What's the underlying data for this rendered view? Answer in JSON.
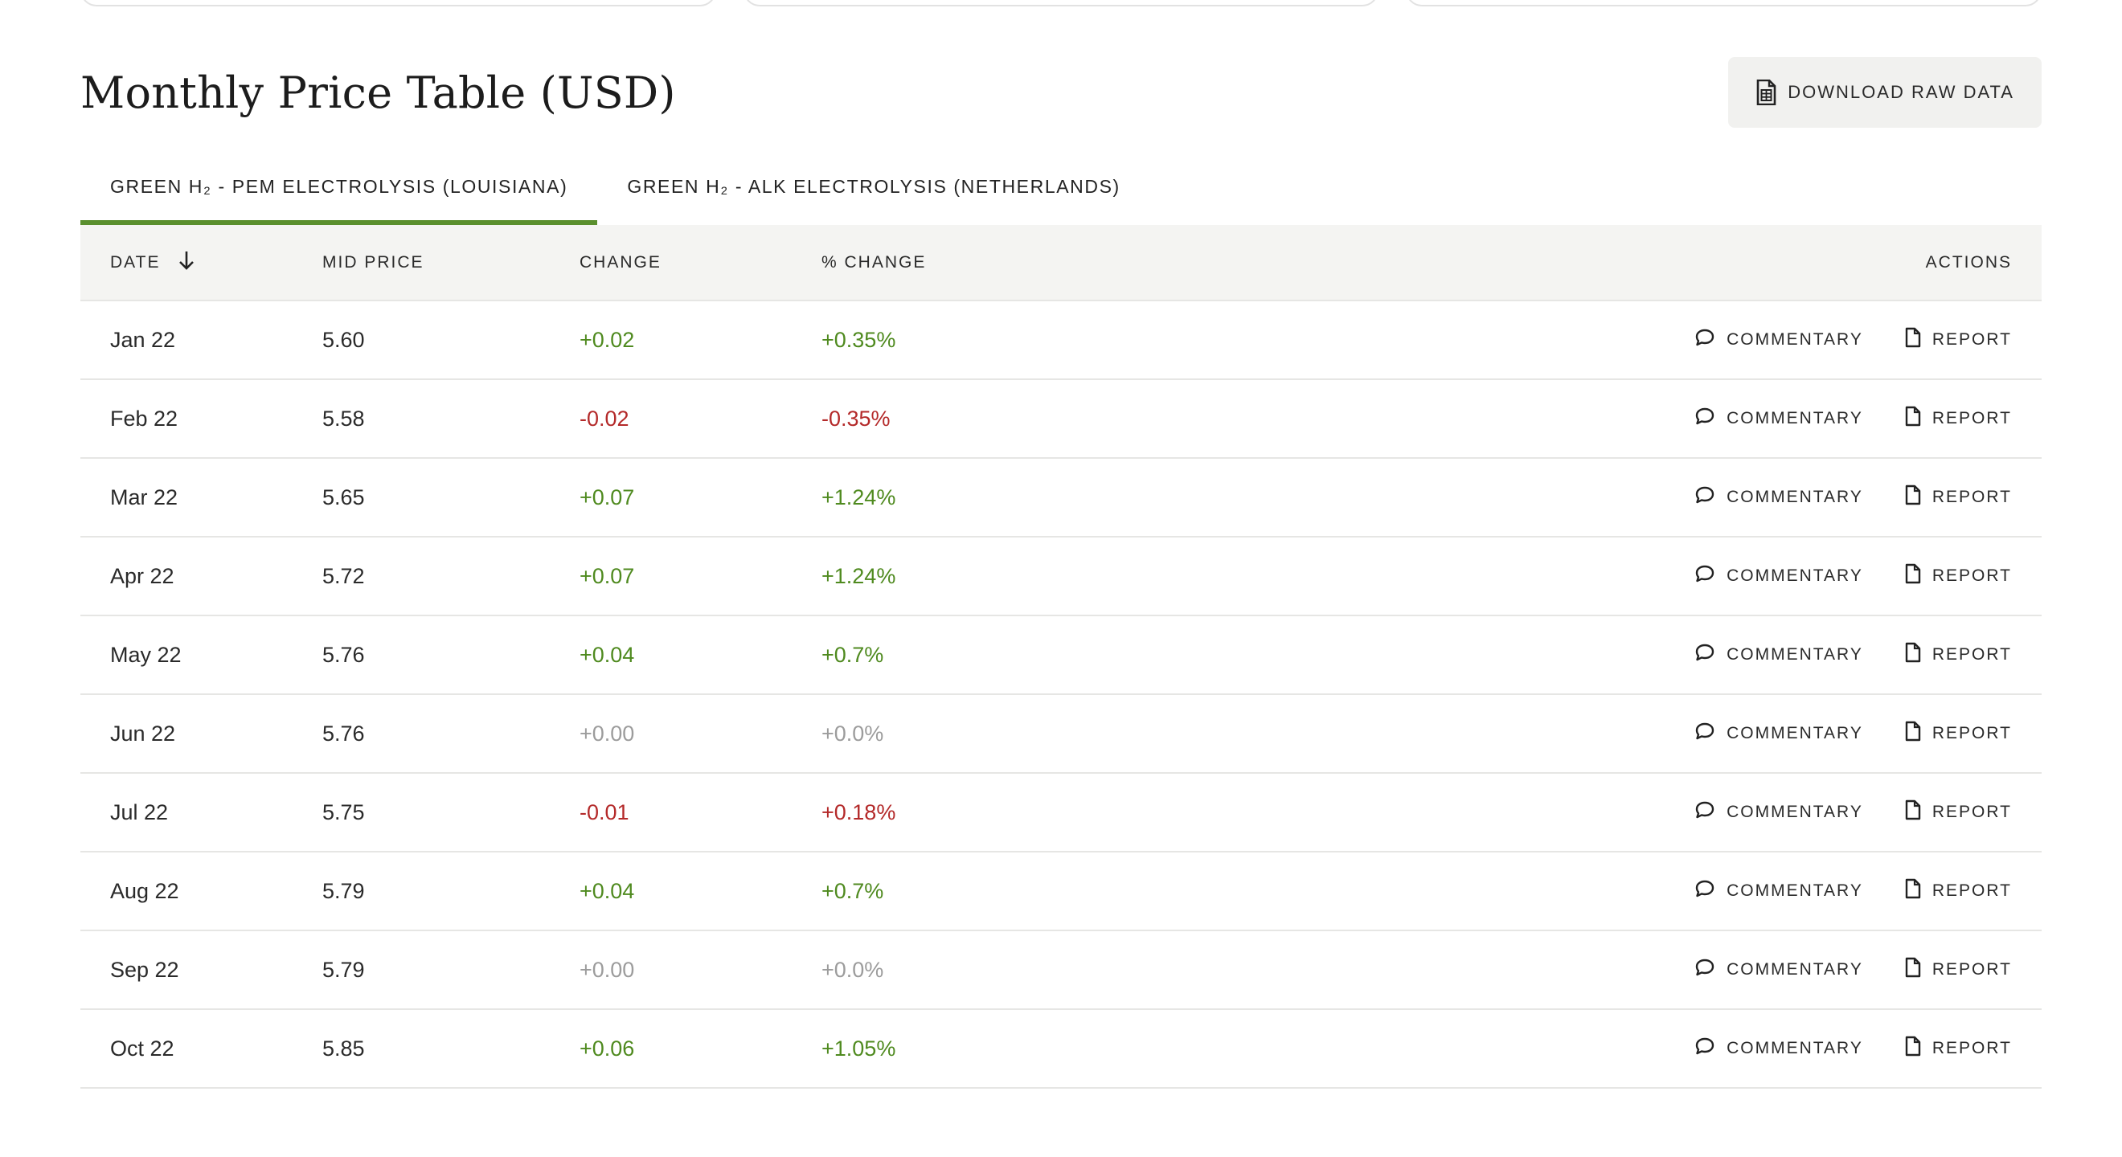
{
  "title": "Monthly Price Table (USD)",
  "download_label": "DOWNLOAD RAW DATA",
  "tabs": [
    {
      "label": "GREEN H₂ - PEM ELECTROLYSIS (LOUISIANA)",
      "active": true
    },
    {
      "label": "GREEN H₂ - ALK ELECTROLYSIS (NETHERLANDS)",
      "active": false
    }
  ],
  "columns": {
    "date": "DATE",
    "mid": "MID PRICE",
    "change": "CHANGE",
    "pct": "% CHANGE",
    "actions": "ACTIONS"
  },
  "actions": {
    "commentary": "COMMENTARY",
    "report": "REPORT"
  },
  "colors": {
    "accent": "#5a8f2e",
    "positive": "#4f8a1f",
    "negative": "#b42a2a",
    "neutral": "#9c9c9c"
  },
  "rows": [
    {
      "date": "Jan 22",
      "mid": "5.60",
      "change": "+0.02",
      "pct": "+0.35%",
      "trend": "pos"
    },
    {
      "date": "Feb 22",
      "mid": "5.58",
      "change": "-0.02",
      "pct": "-0.35%",
      "trend": "neg"
    },
    {
      "date": "Mar 22",
      "mid": "5.65",
      "change": "+0.07",
      "pct": "+1.24%",
      "trend": "pos"
    },
    {
      "date": "Apr 22",
      "mid": "5.72",
      "change": "+0.07",
      "pct": "+1.24%",
      "trend": "pos"
    },
    {
      "date": "May 22",
      "mid": "5.76",
      "change": "+0.04",
      "pct": "+0.7%",
      "trend": "pos"
    },
    {
      "date": "Jun 22",
      "mid": "5.76",
      "change": "+0.00",
      "pct": "+0.0%",
      "trend": "zero"
    },
    {
      "date": "Jul 22",
      "mid": "5.75",
      "change": "-0.01",
      "pct": "+0.18%",
      "trend": "neg"
    },
    {
      "date": "Aug 22",
      "mid": "5.79",
      "change": "+0.04",
      "pct": "+0.7%",
      "trend": "pos"
    },
    {
      "date": "Sep 22",
      "mid": "5.79",
      "change": "+0.00",
      "pct": "+0.0%",
      "trend": "zero"
    },
    {
      "date": "Oct 22",
      "mid": "5.85",
      "change": "+0.06",
      "pct": "+1.05%",
      "trend": "pos"
    }
  ]
}
